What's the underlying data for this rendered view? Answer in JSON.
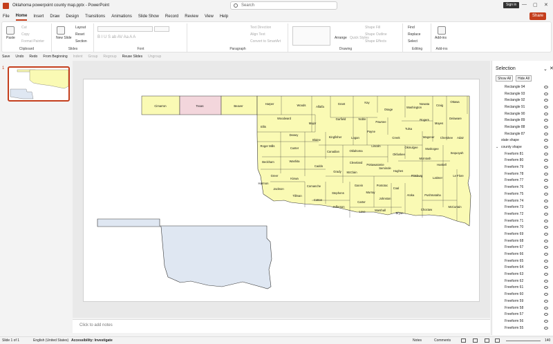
{
  "titlebar": {
    "doc_title": "Oklahoma powerpoint county map.pptx  -  PowerPoint",
    "search_placeholder": "Search",
    "sign_in": "Sign in",
    "minimize": "—",
    "maximize": "▢",
    "close": "✕"
  },
  "tabs": [
    "File",
    "Home",
    "Insert",
    "Draw",
    "Design",
    "Transitions",
    "Animations",
    "Slide Show",
    "Record",
    "Review",
    "View",
    "Help"
  ],
  "share_label": "Share",
  "ribbon": {
    "clipboard": {
      "label": "Clipboard",
      "paste": "Paste",
      "cut": "Cut",
      "copy": "Copy",
      "format_painter": "Format Painter"
    },
    "slides": {
      "label": "Slides",
      "new_slide": "New Slide",
      "layout": "Layout",
      "reset": "Reset",
      "section": "Section"
    },
    "font": {
      "label": "Font",
      "buttons": "B  I  U  S  ab  AV  Aa  A  A"
    },
    "paragraph": {
      "label": "Paragraph",
      "text_direction": "Text Direction",
      "align_text": "Align Text",
      "smartart": "Convert to SmartArt"
    },
    "drawing": {
      "label": "Drawing",
      "arrange": "Arrange",
      "quick_styles": "Quick Styles",
      "shape_fill": "Shape Fill",
      "shape_outline": "Shape Outline",
      "shape_effects": "Shape Effects"
    },
    "editing": {
      "label": "Editing",
      "find": "Find",
      "replace": "Replace",
      "select": "Select"
    },
    "addins": {
      "label": "Add-ins",
      "add_ins": "Add-ins"
    }
  },
  "qat": [
    {
      "label": "Save",
      "enabled": true
    },
    {
      "label": "Undo",
      "enabled": true
    },
    {
      "label": "Redo",
      "enabled": true
    },
    {
      "label": "From Beginning",
      "enabled": true
    },
    {
      "label": "Indent",
      "enabled": false
    },
    {
      "label": "Group",
      "enabled": false
    },
    {
      "label": "Regroup",
      "enabled": false
    },
    {
      "label": "Reuse Slides",
      "enabled": true
    },
    {
      "label": "Ungroup",
      "enabled": false
    }
  ],
  "slide_number": "1",
  "notes_placeholder": "Click to add notes",
  "selection_pane": {
    "title": "Selection",
    "show_all": "Show All",
    "hide_all": "Hide All",
    "items": [
      "Rectangle 94",
      "Rectangle 93",
      "Rectangle 92",
      "Rectangle 91",
      "Rectangle 90",
      "Rectangle 89",
      "Rectangle 88",
      "Rectangle 87",
      "state shape",
      "county shape",
      "Freeform 81",
      "Freeform 80",
      "Freeform 79",
      "Freeform 78",
      "Freeform 77",
      "Freeform 76",
      "Freeform 75",
      "Freeform 74",
      "Freeform 73",
      "Freeform 72",
      "Freeform 71",
      "Freeform 70",
      "Freeform 69",
      "Freeform 68",
      "Freeform 67",
      "Freeform 66",
      "Freeform 65",
      "Freeform 64",
      "Freeform 63",
      "Freeform 62",
      "Freeform 61",
      "Freeform 60",
      "Freeform 59",
      "Freeform 58",
      "Freeform 57",
      "Freeform 56",
      "Freeform 55"
    ]
  },
  "status": {
    "slide": "Slide 1 of 1",
    "language": "English (United States)",
    "accessibility": "Accessibility: Investigate",
    "notes": "Notes",
    "comments": "Comments",
    "zoom": "140"
  },
  "colors": {
    "accent": "#c43e1c",
    "county_fill": "#fafab4",
    "texas_fill": "#f3d6dc",
    "state_fill": "#dfe7f2"
  },
  "counties": [
    "Cimarron",
    "Texas",
    "Beaver",
    "Harper",
    "Woods",
    "Alfalfa",
    "Grant",
    "Kay",
    "Osage",
    "Washington",
    "Nowata",
    "Craig",
    "Ottawa",
    "Woodward",
    "Major",
    "Garfield",
    "Noble",
    "Pawnee",
    "Tulsa",
    "Rogers",
    "Mayes",
    "Delaware",
    "Ellis",
    "Dewey",
    "Blaine",
    "Kingfisher",
    "Logan",
    "Payne",
    "Creek",
    "Wagoner",
    "Cherokee",
    "Adair",
    "Roger Mills",
    "Custer",
    "Canadian",
    "Oklahoma",
    "Lincoln",
    "Okmulgee",
    "Muskogee",
    "Sequoyah",
    "Beckham",
    "Washita",
    "Caddo",
    "Grady",
    "McClain",
    "Cleveland",
    "Pottawatomie",
    "Seminole",
    "Okfuskee",
    "McIntosh",
    "Haskell",
    "Greer",
    "Kiowa",
    "Hughes",
    "Pittsburg",
    "Latimer",
    "Le Flore",
    "Harmon",
    "Jackson",
    "Comanche",
    "Stephens",
    "Garvin",
    "Pontotoc",
    "Coal",
    "Tillman",
    "Cotton",
    "Murray",
    "Johnston",
    "Atoka",
    "Pushmataha",
    "Jefferson",
    "Carter",
    "Love",
    "Marshall",
    "Bryan",
    "Choctaw",
    "McCurtain"
  ]
}
